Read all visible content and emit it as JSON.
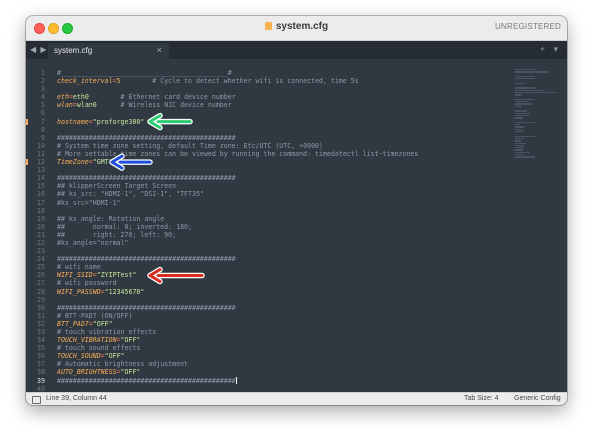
{
  "window": {
    "title": "system.cfg",
    "license_status": "UNREGISTERED"
  },
  "tabs": [
    {
      "label": "system.cfg",
      "close_glyph": "×"
    }
  ],
  "toolbar": {
    "nav_arrows": "◀ ▶",
    "tab_actions": "+ ▾"
  },
  "editor": {
    "current_line": 39,
    "lines": [
      {
        "n": 1,
        "segs": [
          {
            "t": "#__________________________________________#",
            "c": "cm"
          }
        ]
      },
      {
        "n": 2,
        "segs": [
          {
            "t": "check_interval",
            "c": "key"
          },
          {
            "t": "=",
            "c": "op"
          },
          {
            "t": "5",
            "c": "num"
          },
          {
            "t": "        # Cycle to detect whether wifi is connected, time 5s",
            "c": "cm"
          }
        ]
      },
      {
        "n": 3,
        "segs": []
      },
      {
        "n": 4,
        "segs": [
          {
            "t": "eth",
            "c": "key"
          },
          {
            "t": "=",
            "c": "op"
          },
          {
            "t": "eth0",
            "c": "str"
          },
          {
            "t": "        # Ethernet card device number",
            "c": "cm"
          }
        ]
      },
      {
        "n": 5,
        "segs": [
          {
            "t": "wlan",
            "c": "key"
          },
          {
            "t": "=",
            "c": "op"
          },
          {
            "t": "wlan0",
            "c": "str"
          },
          {
            "t": "      # Wireless NIC device number",
            "c": "cm"
          }
        ]
      },
      {
        "n": 6,
        "segs": []
      },
      {
        "n": 7,
        "segs": [
          {
            "t": "hostname",
            "c": "key"
          },
          {
            "t": "=",
            "c": "op"
          },
          {
            "t": "\"proforge300\"",
            "c": "str"
          }
        ]
      },
      {
        "n": 8,
        "segs": []
      },
      {
        "n": 9,
        "segs": [
          {
            "t": "#############################################",
            "c": "cm"
          }
        ]
      },
      {
        "n": 10,
        "segs": [
          {
            "t": "# System time zone setting, default Time zone: Etc/UTC (UTC, +0000)",
            "c": "cm"
          }
        ]
      },
      {
        "n": 11,
        "segs": [
          {
            "t": "# More settable time zones can be viewed by running the command: timedatectl list-timezones",
            "c": "cm"
          }
        ]
      },
      {
        "n": 12,
        "segs": [
          {
            "t": "TimeZone",
            "c": "key"
          },
          {
            "t": "=",
            "c": "op"
          },
          {
            "t": "\"GMT\"",
            "c": "str"
          }
        ]
      },
      {
        "n": 13,
        "segs": []
      },
      {
        "n": 14,
        "segs": [
          {
            "t": "#############################################",
            "c": "cm"
          }
        ]
      },
      {
        "n": 15,
        "segs": [
          {
            "t": "## klipperScreen Target Screen",
            "c": "cm"
          }
        ]
      },
      {
        "n": 16,
        "segs": [
          {
            "t": "## ks_src: \"HDMI-1\", \"DSI-1\", \"TFT35\"",
            "c": "cm"
          }
        ]
      },
      {
        "n": 17,
        "segs": [
          {
            "t": "#ks_src=\"HDMI-1\"",
            "c": "cm"
          }
        ]
      },
      {
        "n": 18,
        "segs": []
      },
      {
        "n": 19,
        "segs": [
          {
            "t": "## ks_angle: Rotation angle",
            "c": "cm"
          }
        ]
      },
      {
        "n": 20,
        "segs": [
          {
            "t": "##       normal: 0; inverted: 180;",
            "c": "cm"
          }
        ]
      },
      {
        "n": 21,
        "segs": [
          {
            "t": "##       right: 270; left: 90;",
            "c": "cm"
          }
        ]
      },
      {
        "n": 22,
        "segs": [
          {
            "t": "#ks_angle=\"normal\"",
            "c": "cm"
          }
        ]
      },
      {
        "n": 23,
        "segs": []
      },
      {
        "n": 24,
        "segs": [
          {
            "t": "#############################################",
            "c": "cm"
          }
        ]
      },
      {
        "n": 25,
        "segs": [
          {
            "t": "# wifi name",
            "c": "cm"
          }
        ]
      },
      {
        "n": 26,
        "segs": [
          {
            "t": "WIFI_SSID",
            "c": "key"
          },
          {
            "t": "=",
            "c": "op"
          },
          {
            "t": "\"ZYIPTest\"",
            "c": "str"
          }
        ]
      },
      {
        "n": 27,
        "segs": [
          {
            "t": "# wifi password",
            "c": "cm"
          }
        ]
      },
      {
        "n": 28,
        "segs": [
          {
            "t": "WIFI_PASSWD",
            "c": "key"
          },
          {
            "t": "=",
            "c": "op"
          },
          {
            "t": "\"12345678\"",
            "c": "str"
          }
        ]
      },
      {
        "n": 29,
        "segs": []
      },
      {
        "n": 30,
        "segs": [
          {
            "t": "#############################################",
            "c": "cm"
          }
        ]
      },
      {
        "n": 31,
        "segs": [
          {
            "t": "# BTT-PAD7 (ON/OFF)",
            "c": "cm"
          }
        ]
      },
      {
        "n": 32,
        "segs": [
          {
            "t": "BTT_PAD7",
            "c": "key"
          },
          {
            "t": "=",
            "c": "op"
          },
          {
            "t": "\"OFF\"",
            "c": "str"
          }
        ]
      },
      {
        "n": 33,
        "segs": [
          {
            "t": "# touch vibration effects",
            "c": "cm"
          }
        ]
      },
      {
        "n": 34,
        "segs": [
          {
            "t": "TOUCH_VIBRATION",
            "c": "key"
          },
          {
            "t": "=",
            "c": "op"
          },
          {
            "t": "\"OFF\"",
            "c": "str"
          }
        ]
      },
      {
        "n": 35,
        "segs": [
          {
            "t": "# touch sound effects",
            "c": "cm"
          }
        ]
      },
      {
        "n": 36,
        "segs": [
          {
            "t": "TOUCH_SOUND",
            "c": "key"
          },
          {
            "t": "=",
            "c": "op"
          },
          {
            "t": "\"OFF\"",
            "c": "str"
          }
        ]
      },
      {
        "n": 37,
        "segs": [
          {
            "t": "# Automatic brightness adjustment",
            "c": "cm"
          }
        ]
      },
      {
        "n": 38,
        "segs": [
          {
            "t": "AUTO_BRIGHTNESS",
            "c": "key"
          },
          {
            "t": "=",
            "c": "op"
          },
          {
            "t": "\"OFF\"",
            "c": "str"
          }
        ]
      },
      {
        "n": 39,
        "segs": [
          {
            "t": "#############################################",
            "c": "cm"
          }
        ]
      },
      {
        "n": 40,
        "segs": []
      }
    ]
  },
  "status": {
    "position": "Line 39, Column 44",
    "tab_size": "Tab Size: 4",
    "syntax": "Generic Config"
  },
  "annotations": [
    {
      "name": "arrow-hostname",
      "line": 7,
      "color": "#2ecc71"
    },
    {
      "name": "arrow-timezone",
      "line": 12,
      "color": "#1f4fd8"
    },
    {
      "name": "arrow-wifi-ssid",
      "line": 26,
      "color": "#d92b1f"
    }
  ],
  "colors": {
    "background": "#303841",
    "comment": "#8e98a5",
    "key": "#f9ae58",
    "operator": "#f97b58",
    "string": "#c5e89a"
  }
}
